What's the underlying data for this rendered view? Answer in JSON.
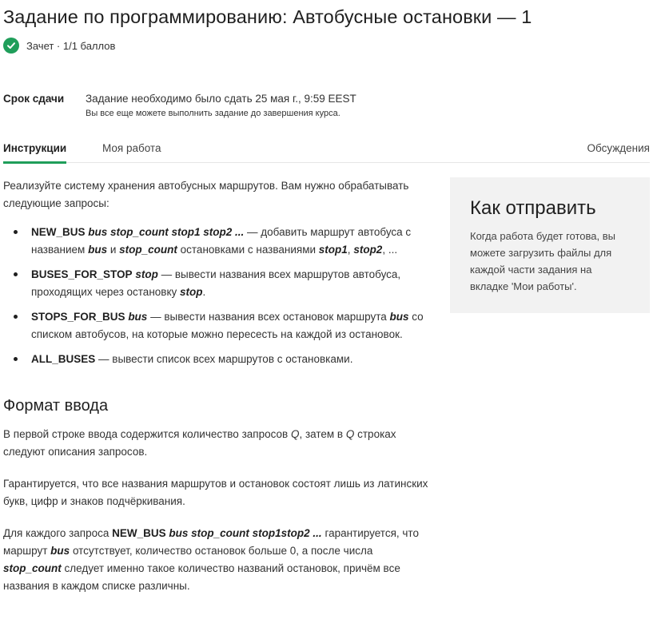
{
  "page": {
    "title": "Задание по программированию: Автобусные остановки — 1",
    "grade_text": "Зачет · 1/1 баллов"
  },
  "deadline": {
    "label": "Срок сдачи",
    "text": "Задание необходимо было сдать 25 мая г., 9:59 EEST",
    "note": "Вы все еще можете выполнить задание до завершения курса."
  },
  "tabs": {
    "instructions": "Инструкции",
    "my_work": "Моя работа",
    "discussions": "Обсуждения"
  },
  "content": {
    "intro": "Реализуйте систему хранения автобусных маршрутов. Вам нужно обрабатывать следующие запросы:",
    "items": [
      {
        "cmd": "NEW_BUS",
        "args": "bus stop_count stop1 stop2 ...",
        "t1": " — добавить маршрут автобуса с названием ",
        "a1": "bus",
        "t2": " и ",
        "a2": "stop_count",
        "t3": " остановками с названиями ",
        "a3": "stop1",
        "t4": ", ",
        "a4": "stop2",
        "t5": ", ..."
      },
      {
        "cmd": "BUSES_FOR_STOP",
        "args": "stop",
        "t1": " — вывести названия всех маршрутов автобуса, проходящих через остановку ",
        "a1": "stop",
        "t2": "."
      },
      {
        "cmd": "STOPS_FOR_BUS",
        "args": "bus",
        "t1": " — вывести названия всех остановок маршрута ",
        "a1": "bus",
        "t2": " со списком автобусов, на которые можно пересесть на каждой из остановок."
      },
      {
        "cmd": "ALL_BUSES",
        "t1": " — вывести список всех маршрутов с остановками."
      }
    ],
    "input_format_title": "Формат ввода",
    "para1": {
      "t1": "В первой строке ввода содержится количество запросов ",
      "q1": "Q",
      "t2": ", затем в ",
      "q2": "Q",
      "t3": " строках следуют описания запросов."
    },
    "para2": "Гарантируется, что все названия маршрутов и остановок состоят лишь из латинских букв, цифр и знаков подчёркивания.",
    "para3": {
      "t1": "Для каждого запроса ",
      "cmd": "NEW_BUS",
      "args": "bus stop_count stop1stop2 ...",
      "t2": " гарантируется, что маршрут ",
      "a1": "bus",
      "t3": " отсутствует, количество остановок больше 0, а после числа ",
      "a2": "stop_count",
      "t4": " следует именно такое количество названий остановок, причём все названия в каждом списке различны."
    }
  },
  "sidebar": {
    "title": "Как отправить",
    "text": "Когда работа будет готова, вы можете загрузить файлы для каждой части задания на вкладке 'Мои работы'."
  },
  "colors": {
    "accent_green": "#1f9e5a",
    "sidebar_bg": "#f2f2f2"
  },
  "icons": {
    "grade": "check-circle-icon"
  }
}
